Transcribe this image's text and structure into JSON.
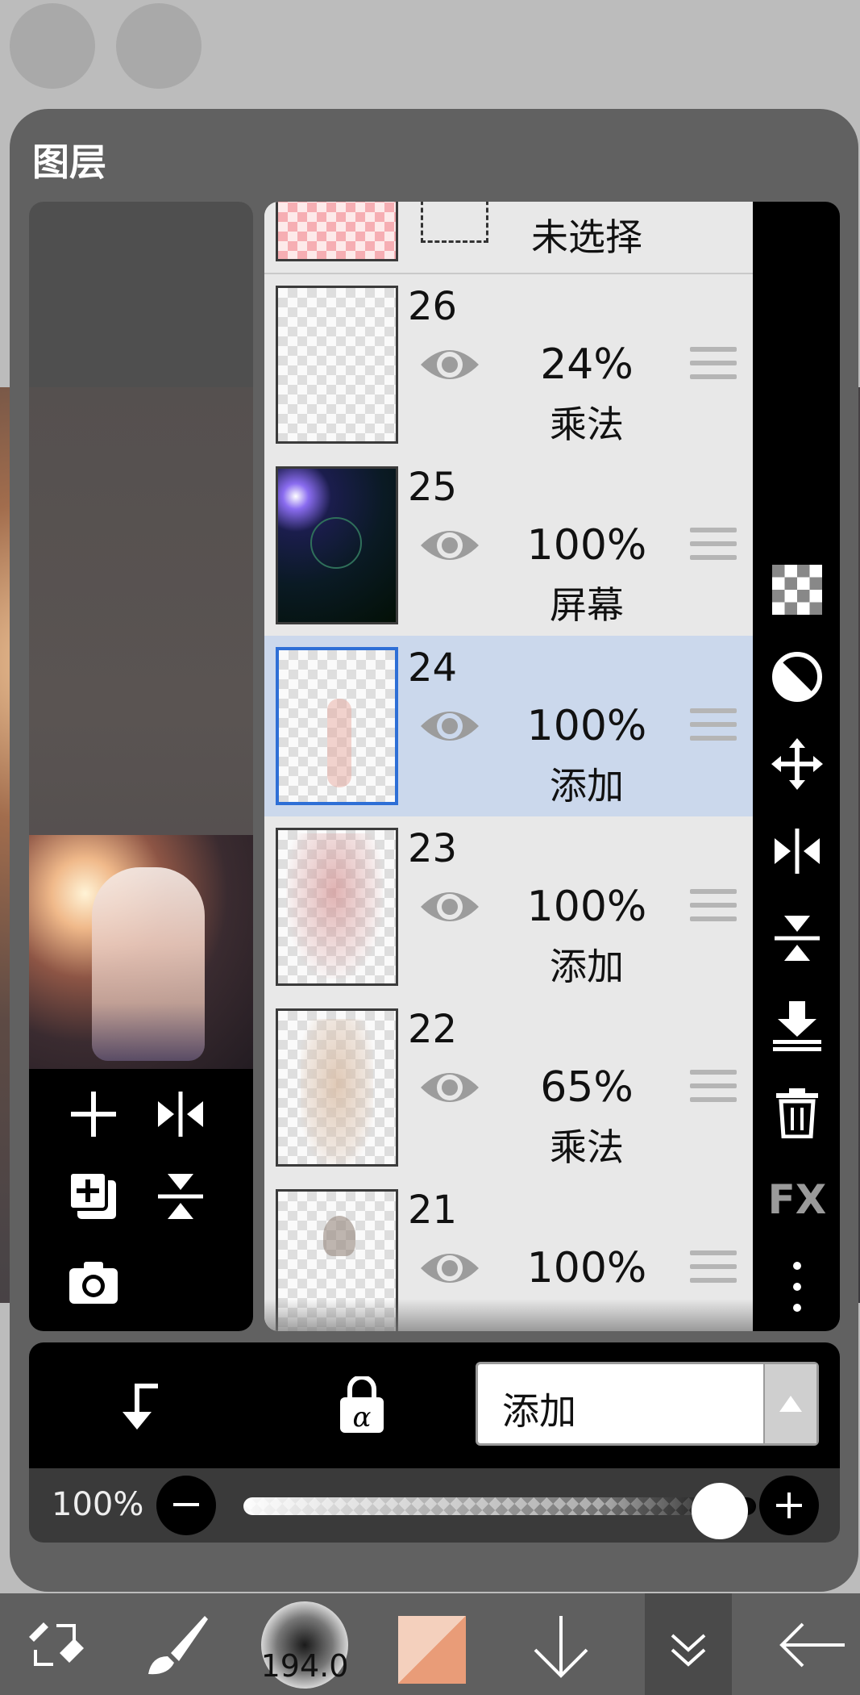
{
  "panel": {
    "title": "图层"
  },
  "layers": [
    {
      "number": "",
      "opacity": "",
      "blend": "未选择",
      "selected": false
    },
    {
      "number": "26",
      "opacity": "24%",
      "blend": "乘法",
      "selected": false
    },
    {
      "number": "25",
      "opacity": "100%",
      "blend": "屏幕",
      "selected": false
    },
    {
      "number": "24",
      "opacity": "100%",
      "blend": "添加",
      "selected": true
    },
    {
      "number": "23",
      "opacity": "100%",
      "blend": "添加",
      "selected": false
    },
    {
      "number": "22",
      "opacity": "65%",
      "blend": "乘法",
      "selected": false
    },
    {
      "number": "21",
      "opacity": "100%",
      "blend": "",
      "selected": false
    }
  ],
  "blend_mode": {
    "selected": "添加"
  },
  "opacity": {
    "label": "100%",
    "value": 1.0
  },
  "toolbar": {
    "brush_size": "194.0"
  },
  "right_bar": {
    "fx_label": "FX"
  },
  "colors": {
    "accent": "#2e6fd6",
    "selected_row": "#cbd8ec",
    "panel": "#616161"
  }
}
